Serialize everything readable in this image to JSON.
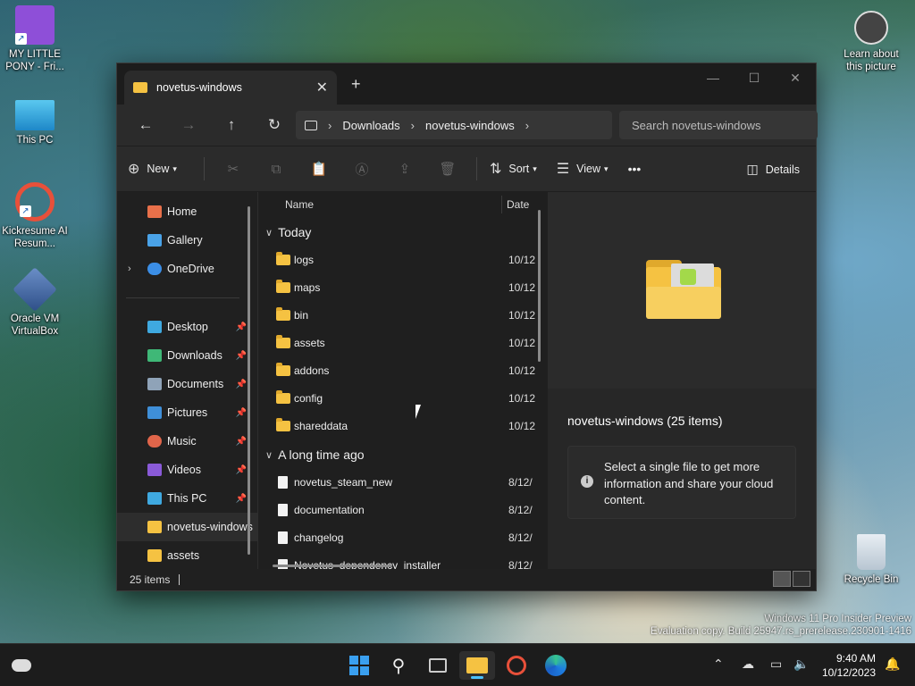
{
  "desktop": {
    "icons": [
      {
        "label": "MY LITTLE PONY - Fri..."
      },
      {
        "label": "This PC"
      },
      {
        "label": "Kickresume AI Resum..."
      },
      {
        "label": "Oracle VM VirtualBox"
      }
    ],
    "right_icons": [
      {
        "label": "Learn about this picture"
      },
      {
        "label": "Recycle Bin"
      }
    ],
    "watermark_line1": "Windows 11 Pro Insider Preview",
    "watermark_line2": "Evaluation copy. Build 25947.rs_prerelease.230901-1416"
  },
  "window": {
    "tab_title": "novetus-windows",
    "breadcrumb": [
      "Downloads",
      "novetus-windows"
    ],
    "search_placeholder": "Search novetus-windows",
    "toolbar": {
      "new_label": "New",
      "sort_label": "Sort",
      "view_label": "View",
      "more_label": "•••",
      "details_label": "Details"
    },
    "sidebar": {
      "top_items": [
        {
          "label": "Home",
          "color": "#e8704a"
        },
        {
          "label": "Gallery",
          "color": "#4aa3e8"
        },
        {
          "label": "OneDrive",
          "color": "#3b8ee6"
        }
      ],
      "pinned_items": [
        {
          "label": "Desktop",
          "color": "#3fa9e0"
        },
        {
          "label": "Downloads",
          "color": "#3fb877"
        },
        {
          "label": "Documents",
          "color": "#8fa3b8"
        },
        {
          "label": "Pictures",
          "color": "#3f8fd8"
        },
        {
          "label": "Music",
          "color": "#e0654a"
        },
        {
          "label": "Videos",
          "color": "#8a5ad8"
        },
        {
          "label": "This PC",
          "color": "#3fa9e0"
        }
      ],
      "folder_items": [
        {
          "label": "novetus-windows",
          "color": "#f5c242"
        },
        {
          "label": "assets",
          "color": "#f5c242"
        }
      ]
    },
    "columns": {
      "name": "Name",
      "date": "Date"
    },
    "groups": [
      {
        "label": "Today",
        "rows": [
          {
            "name": "logs",
            "date": "10/12",
            "kind": "folder"
          },
          {
            "name": "maps",
            "date": "10/12",
            "kind": "folder"
          },
          {
            "name": "bin",
            "date": "10/12",
            "kind": "folder"
          },
          {
            "name": "assets",
            "date": "10/12",
            "kind": "folder"
          },
          {
            "name": "addons",
            "date": "10/12",
            "kind": "folder"
          },
          {
            "name": "config",
            "date": "10/12",
            "kind": "folder"
          },
          {
            "name": "shareddata",
            "date": "10/12",
            "kind": "folder"
          }
        ]
      },
      {
        "label": "A long time ago",
        "rows": [
          {
            "name": "novetus_steam_new",
            "date": "8/12/",
            "kind": "file"
          },
          {
            "name": "documentation",
            "date": "8/12/",
            "kind": "file"
          },
          {
            "name": "changelog",
            "date": "8/12/",
            "kind": "file"
          },
          {
            "name": "Novetus_dependency_installer",
            "date": "8/12/",
            "kind": "file"
          }
        ]
      }
    ],
    "details_pane": {
      "title": "novetus-windows (25 items)",
      "message": "Select a single file to get more information and share your cloud content."
    },
    "status": "25 items"
  },
  "taskbar": {
    "time": "9:40 AM",
    "date": "10/12/2023"
  }
}
